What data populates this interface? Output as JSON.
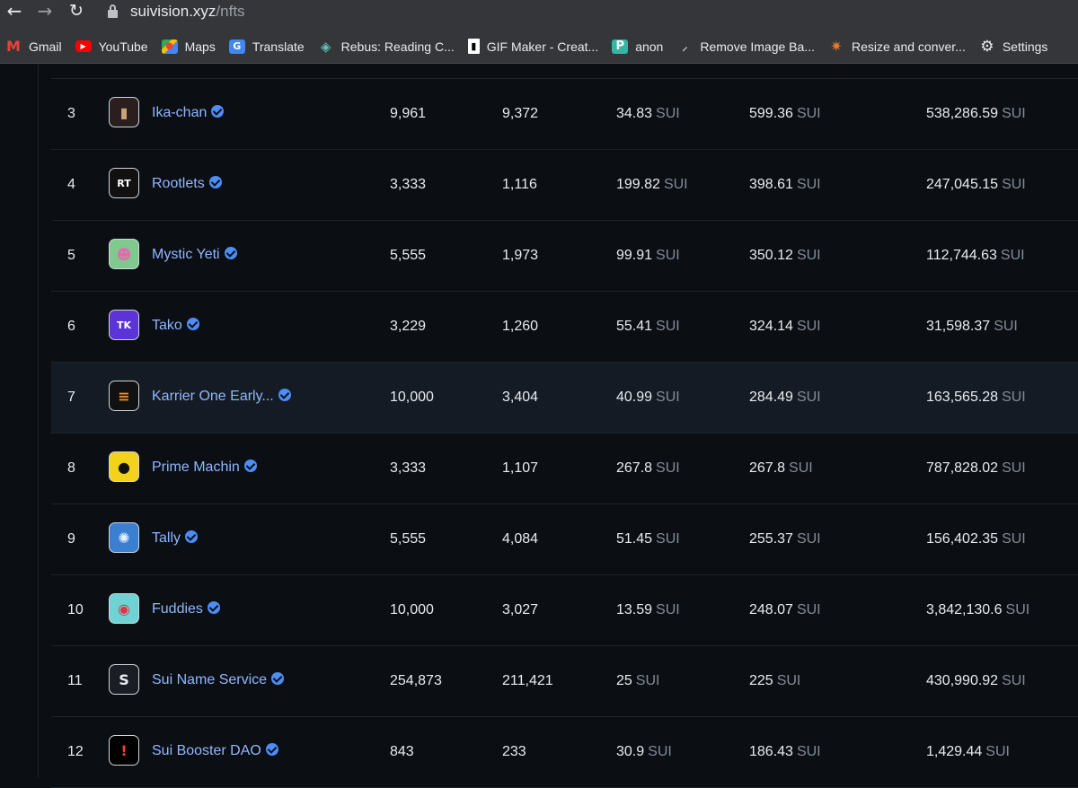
{
  "browser": {
    "url_host": "suivision.xyz",
    "url_path": "/nfts",
    "bookmarks": [
      {
        "label": "Gmail",
        "icon": "gmail-icon",
        "glyph": "M"
      },
      {
        "label": "YouTube",
        "icon": "youtube-icon",
        "glyph": "▶"
      },
      {
        "label": "Maps",
        "icon": "maps-icon",
        "glyph": "●"
      },
      {
        "label": "Translate",
        "icon": "translate-icon",
        "glyph": "G"
      },
      {
        "label": "Rebus: Reading C...",
        "icon": "rebus-icon",
        "glyph": "◈"
      },
      {
        "label": "GIF Maker - Creat...",
        "icon": "gif-maker-icon",
        "glyph": "▮"
      },
      {
        "label": "anon",
        "icon": "anon-icon",
        "glyph": "P"
      },
      {
        "label": "Remove Image Ba...",
        "icon": "remove-bg-icon",
        "glyph": "⸝"
      },
      {
        "label": "Resize and conver...",
        "icon": "resize-icon",
        "glyph": "✷"
      },
      {
        "label": "Settings",
        "icon": "settings-icon",
        "glyph": "⚙"
      }
    ]
  },
  "unit": "SUI",
  "rows": [
    {
      "rank": "3",
      "name": "Ika-chan",
      "c1": "9,961",
      "c2": "9,372",
      "c3": "34.83",
      "c4": "599.36",
      "c5": "538,286.59",
      "thumb_bg": "#2a1e1e",
      "thumb_fg": "#c9a27a",
      "thumb_text": "▮"
    },
    {
      "rank": "4",
      "name": "Rootlets",
      "c1": "3,333",
      "c2": "1,116",
      "c3": "199.82",
      "c4": "398.61",
      "c5": "247,045.15",
      "thumb_bg": "#111111",
      "thumb_fg": "#ffffff",
      "thumb_text": "RT"
    },
    {
      "rank": "5",
      "name": "Mystic Yeti",
      "c1": "5,555",
      "c2": "1,973",
      "c3": "99.91",
      "c4": "350.12",
      "c5": "112,744.63",
      "thumb_bg": "#7fc98f",
      "thumb_fg": "#e46ab0",
      "thumb_text": "☻"
    },
    {
      "rank": "6",
      "name": "Tako",
      "c1": "3,229",
      "c2": "1,260",
      "c3": "55.41",
      "c4": "324.14",
      "c5": "31,598.37",
      "thumb_bg": "#5b33d6",
      "thumb_fg": "#ffffff",
      "thumb_text": "TK"
    },
    {
      "rank": "7",
      "name": "Karrier One Early...",
      "c1": "10,000",
      "c2": "3,404",
      "c3": "40.99",
      "c4": "284.49",
      "c5": "163,565.28",
      "thumb_bg": "#111111",
      "thumb_fg": "#f08a2a",
      "thumb_text": "≡"
    },
    {
      "rank": "8",
      "name": "Prime Machin",
      "c1": "3,333",
      "c2": "1,107",
      "c3": "267.8",
      "c4": "267.8",
      "c5": "787,828.02",
      "thumb_bg": "#f2d21b",
      "thumb_fg": "#111111",
      "thumb_text": "●"
    },
    {
      "rank": "9",
      "name": "Tally",
      "c1": "5,555",
      "c2": "4,084",
      "c3": "51.45",
      "c4": "255.37",
      "c5": "156,402.35",
      "thumb_bg": "#3a7fd0",
      "thumb_fg": "#e6f2ff",
      "thumb_text": "✺"
    },
    {
      "rank": "10",
      "name": "Fuddies",
      "c1": "10,000",
      "c2": "3,027",
      "c3": "13.59",
      "c4": "248.07",
      "c5": "3,842,130.6",
      "thumb_bg": "#6fd3d6",
      "thumb_fg": "#e03545",
      "thumb_text": "◉"
    },
    {
      "rank": "11",
      "name": "Sui Name Service",
      "c1": "254,873",
      "c2": "211,421",
      "c3": "25",
      "c4": "225",
      "c5": "430,990.92",
      "thumb_bg": "#1a1d24",
      "thumb_fg": "#e8ecf1",
      "thumb_text": "S"
    },
    {
      "rank": "12",
      "name": "Sui Booster DAO",
      "c1": "843",
      "c2": "233",
      "c3": "30.9",
      "c4": "186.43",
      "c5": "1,429.44",
      "thumb_bg": "#000000",
      "thumb_fg": "#ff3b30",
      "thumb_text": "!"
    }
  ],
  "highlight_rank": "7"
}
